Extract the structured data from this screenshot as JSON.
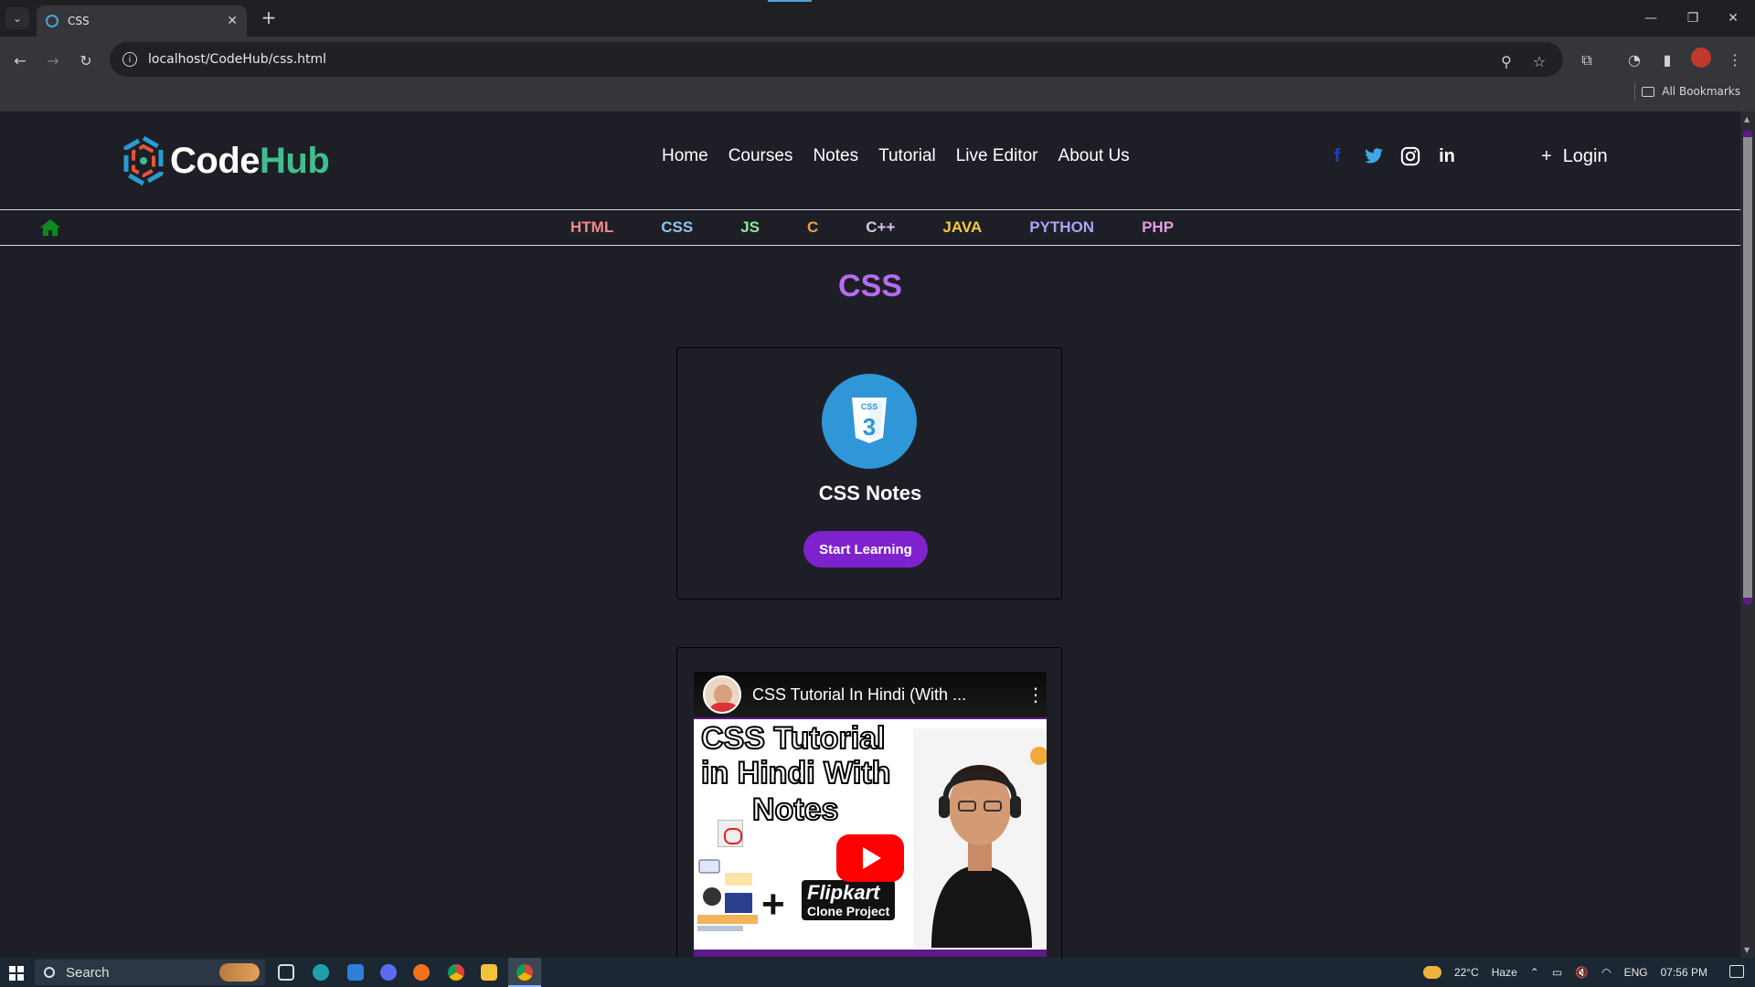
{
  "browser": {
    "tab_title": "CSS",
    "url": "localhost/CodeHub/css.html",
    "bookmarks_label": "All Bookmarks"
  },
  "site": {
    "logo_code": "Code",
    "logo_hub": "Hub",
    "nav": [
      "Home",
      "Courses",
      "Notes",
      "Tutorial",
      "Live Editor",
      "About Us"
    ],
    "social": [
      {
        "name": "facebook-icon",
        "glyph": "f",
        "color": "#1a3fd1"
      },
      {
        "name": "twitter-icon",
        "glyph": "🐦",
        "color": "#41a6e8"
      },
      {
        "name": "instagram-icon",
        "glyph": "◎",
        "color": "#ffffff"
      },
      {
        "name": "linkedin-icon",
        "glyph": "in",
        "color": "#ffffff"
      }
    ],
    "login_label": "Login",
    "languages": [
      {
        "label": "HTML",
        "color": "#f08a8a"
      },
      {
        "label": "CSS",
        "color": "#8cc6f0"
      },
      {
        "label": "JS",
        "color": "#8ee6a0"
      },
      {
        "label": "C",
        "color": "#f0a040"
      },
      {
        "label": "C++",
        "color": "#d9c7f0"
      },
      {
        "label": "JAVA",
        "color": "#f0cc3c"
      },
      {
        "label": "PYTHON",
        "color": "#a9a4f0"
      },
      {
        "label": "PHP",
        "color": "#e29ce0"
      }
    ],
    "home_icon_color": "#0d8a1f"
  },
  "main": {
    "page_title": "CSS",
    "card_title": "CSS Notes",
    "start_button": "Start Learning",
    "accent_color": "#7e22ce",
    "video": {
      "title": "CSS Tutorial In Hindi (With ...",
      "thumb_line1": "CSS Tutorial",
      "thumb_line2": "in Hindi With",
      "thumb_line3": "Notes",
      "flip_main": "Flipkart",
      "flip_sub": "Clone Project"
    }
  },
  "taskbar": {
    "search_placeholder": "Search",
    "temperature": "22°C",
    "weather": "Haze",
    "language": "ENG",
    "time": "07:56 PM"
  }
}
